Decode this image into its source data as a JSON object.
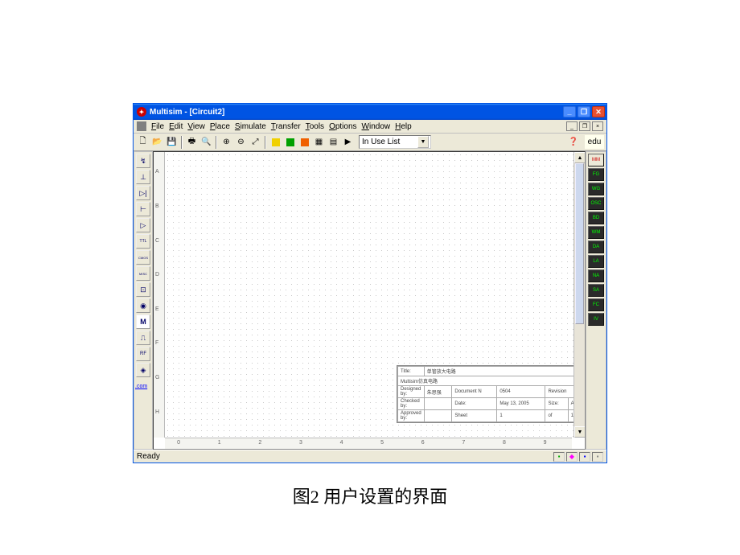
{
  "caption": "图2  用户设置的界面",
  "titlebar": {
    "app": "Multisim",
    "doc": "[Circuit2]"
  },
  "menu": {
    "file": "File",
    "edit": "Edit",
    "view": "View",
    "place": "Place",
    "simulate": "Simulate",
    "transfer": "Transfer",
    "tools": "Tools",
    "options": "Options",
    "window": "Window",
    "help": "Help"
  },
  "toolbar": {
    "in_use": "In Use List",
    "simulate_label": "▶",
    "pause_label": "||"
  },
  "ruler_v": [
    "A",
    "B",
    "C",
    "D",
    "E",
    "F",
    "G",
    "H"
  ],
  "ruler_h": [
    "0",
    "1",
    "2",
    "3",
    "4",
    "5",
    "6",
    "7",
    "8",
    "9"
  ],
  "titleblock": {
    "title_lbl": "Title:",
    "title_val": "单管放大电路",
    "subtitle": "Multisim仿真电路",
    "designed_lbl": "Designed by:",
    "designed_val": "朱思强",
    "docnum_lbl": "Document N",
    "docnum_val": "0504",
    "rev_lbl": "Revision",
    "checked_lbl": "Checked by:",
    "date_lbl": "Date:",
    "date_val": "May 13, 2005",
    "size_lbl": "Size:",
    "size_val": "A",
    "approved_lbl": "Approved by:",
    "sheet_lbl": "Sheet",
    "sheet_val": "1",
    "of_lbl": "of",
    "of_val": "1"
  },
  "status": {
    "ready": "Ready"
  },
  "left_toolbar": {
    "link": ".com"
  },
  "icons": {
    "source": "↯",
    "basic": "⊥",
    "diode": "▷|",
    "transistor": "⊢",
    "analog": "▷",
    "ttl": "TTL",
    "cmos": "CMOS",
    "misc_d": "MISC",
    "mixed": "⊡",
    "indicator": "◉",
    "misc": "M",
    "electro": "⎍",
    "rf": "RF",
    "em": "◈"
  },
  "instruments": [
    "MM",
    "FG",
    "WG",
    "OSC",
    "BD",
    "WM",
    "DA",
    "LA",
    "NA",
    "SA",
    "FC",
    "IV"
  ]
}
